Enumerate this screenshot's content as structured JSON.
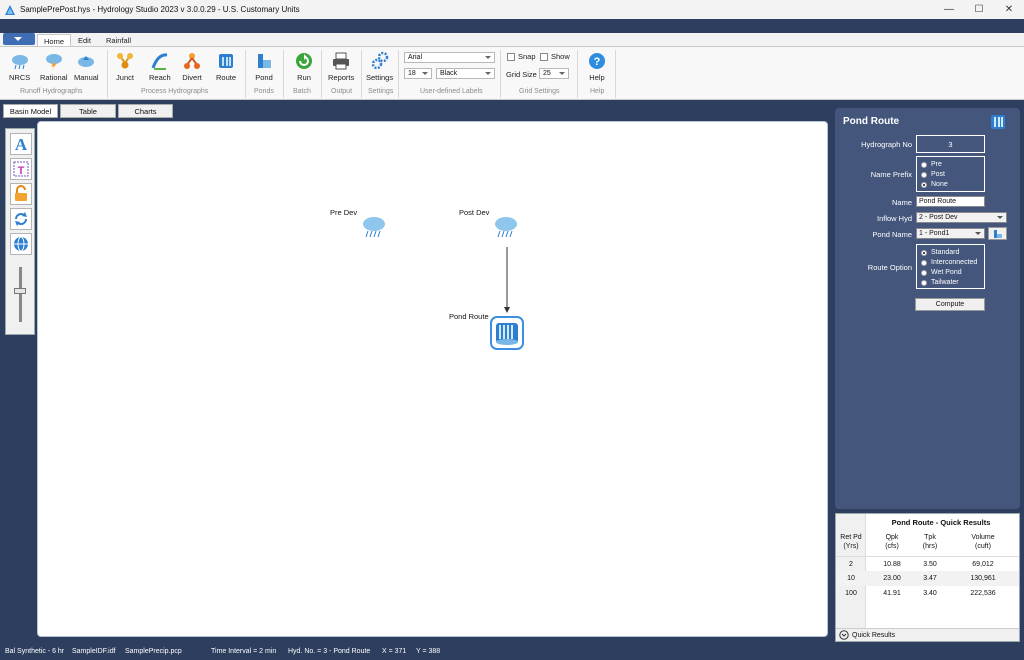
{
  "window": {
    "title": "SamplePrePost.hys - Hydrology Studio 2023 v 3.0.0.29 - U.S. Customary Units",
    "min": "—",
    "max": "☐",
    "close": "✕"
  },
  "ribbon_tabs": [
    "Home",
    "Edit",
    "Rainfall"
  ],
  "ribbon": {
    "buttons": {
      "nrcs": "NRCS",
      "rational": "Rational",
      "manual": "Manual",
      "junct": "Junct",
      "reach": "Reach",
      "divert": "Divert",
      "route": "Route",
      "pond": "Pond",
      "run": "Run",
      "reports": "Reports",
      "settings": "Settings",
      "help": "Help"
    },
    "groups": {
      "runoff": "Runoff Hydrographs",
      "process": "Process Hydrographs",
      "ponds": "Ponds",
      "batch": "Batch",
      "output": "Output",
      "settings": "Settings",
      "labels": "User-defined Labels",
      "grid": "Grid Settings",
      "help": "Help"
    },
    "font": "Arial",
    "font_size": "18",
    "color": "Black",
    "snap_label": "Snap",
    "show_label": "Show",
    "grid_size_label": "Grid Size",
    "grid_size": "25"
  },
  "view_tabs": [
    "Basin Model",
    "Table",
    "Charts"
  ],
  "canvas": {
    "nodes": {
      "pre_dev": "Pre Dev",
      "post_dev": "Post Dev",
      "pond_route": "Pond Route"
    }
  },
  "panel": {
    "title": "Pond Route",
    "hydrograph_no_label": "Hydrograph No",
    "hydrograph_no": "3",
    "name_prefix_label": "Name Prefix",
    "prefix_options": [
      "Pre",
      "Post",
      "None"
    ],
    "name_label": "Name",
    "name_value": "Pond Route",
    "inflow_label": "Inflow Hyd",
    "inflow_value": "2 - Post Dev",
    "pond_name_label": "Pond Name",
    "pond_name_value": "1 - Pond1",
    "route_option_label": "Route Option",
    "route_options": [
      "Standard",
      "Interconnected",
      "Wet Pond",
      "Tailwater"
    ],
    "compute": "Compute"
  },
  "quick_results": {
    "title": "Pond Route - Quick Results",
    "headers": [
      {
        "l1": "Ret Pd",
        "l2": "(Yrs)"
      },
      {
        "l1": "Qpk",
        "l2": "(cfs)"
      },
      {
        "l1": "Tpk",
        "l2": "(hrs)"
      },
      {
        "l1": "Volume",
        "l2": "(cuft)"
      }
    ],
    "rows": [
      [
        "2",
        "10.88",
        "3.50",
        "69,012"
      ],
      [
        "10",
        "23.00",
        "3.47",
        "130,961"
      ],
      [
        "100",
        "41.91",
        "3.40",
        "222,536"
      ]
    ],
    "footer": "Quick Results"
  },
  "status": {
    "storm": "Bal Synthetic - 6 hr",
    "idf": "SampleIDF.idf",
    "precip": "SamplePrecip.pcp",
    "interval": "Time Interval = 2 min",
    "hyd": "Hyd. No. = 3 - Pond Route",
    "x": "X = 371",
    "y": "Y = 388"
  }
}
